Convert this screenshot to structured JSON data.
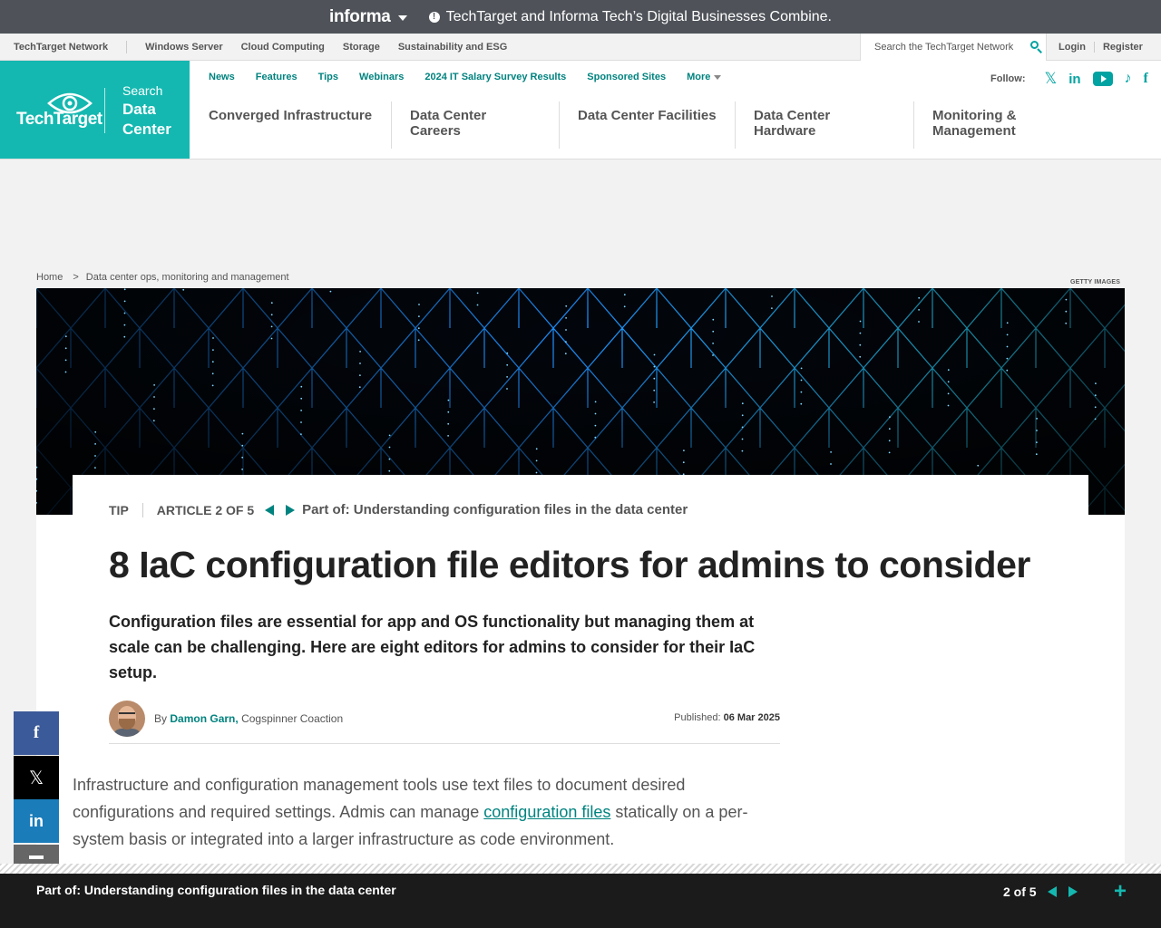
{
  "informa": {
    "logo": "informa",
    "message": "TechTarget and Informa Tech’s Digital Businesses Combine."
  },
  "network": {
    "name": "TechTarget Network",
    "links": [
      "Windows Server",
      "Cloud Computing",
      "Storage",
      "Sustainability and ESG"
    ],
    "search_placeholder": "Search the TechTarget Network",
    "login": "Login",
    "register": "Register"
  },
  "site": {
    "brand": "TechTarget",
    "search_label": "Search",
    "name_line1": "Data",
    "name_line2": "Center",
    "brand_color": "#14b8b0",
    "accent_color": "#00837f"
  },
  "top_nav": [
    "News",
    "Features",
    "Tips",
    "Webinars",
    "2024 IT Salary Survey Results",
    "Sponsored Sites",
    "More"
  ],
  "follow_label": "Follow:",
  "social_icons": [
    "x-icon",
    "linkedin-icon",
    "youtube-icon",
    "tiktok-icon",
    "facebook-icon"
  ],
  "categories": [
    "Converged Infrastructure",
    "Data Center Careers",
    "Data Center Facilities",
    "Data Center Hardware",
    "Monitoring & Management"
  ],
  "breadcrumb": [
    "Home",
    ">",
    "Data center ops, monitoring and management"
  ],
  "image_credit": "GETTY IMAGES",
  "article": {
    "type": "TIP",
    "position": "ARTICLE 2 OF 5",
    "series": "Part of: Understanding configuration files in the data center",
    "headline": "8 IaC configuration file editors for admins to consider",
    "dek": "Configuration files are essential for app and OS functionality but managing them at scale can be challenging. Here are eight editors for admins to consider for their IaC setup.",
    "by": "By",
    "author": "Damon Garn,",
    "affiliation": "Cogspinner Coaction",
    "published_label": "Published:",
    "published_date": "06 Mar 2025",
    "body_before": "Infrastructure and configuration management tools use text files to document desired configurations and required settings. Admis can manage ",
    "body_link": "configuration files",
    "body_after": " statically on a per-system basis or integrated into a larger infrastructure as code environment."
  },
  "share": [
    "f",
    "𝕏",
    "in"
  ],
  "series_bar": {
    "title": "Part of: Understanding configuration files in the data center",
    "count": "2 of 5",
    "expand": "+"
  }
}
